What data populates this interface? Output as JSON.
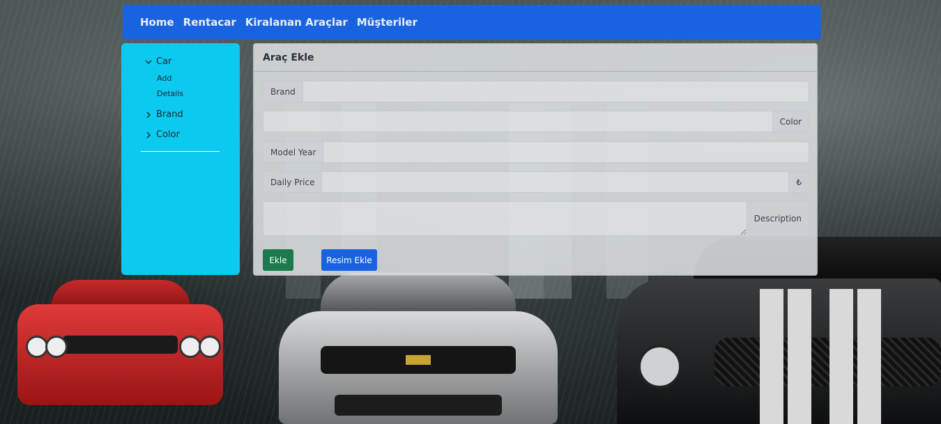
{
  "navbar": {
    "links": [
      "Home",
      "Rentacar",
      "Kiralanan Araçlar",
      "Müşteriler"
    ]
  },
  "sidebar": {
    "car": {
      "label": "Car",
      "children": [
        "Add",
        "Details"
      ]
    },
    "brand": {
      "label": "Brand"
    },
    "color": {
      "label": "Color"
    }
  },
  "form": {
    "title": "Araç Ekle",
    "brand_label": "Brand",
    "brand_value": "",
    "color_label": "Color",
    "color_value": "",
    "model_year_label": "Model Year",
    "model_year_value": "",
    "daily_price_label": "Daily Price",
    "daily_price_value": "",
    "currency_symbol": "₺",
    "description_label": "Description",
    "description_value": "",
    "add_button": "Ekle",
    "add_image_button": "Resim Ekle"
  },
  "colors": {
    "navbar": "#1a63e0",
    "sidebar": "#0bc9ef",
    "add_button": "#1a7a4d",
    "add_image_button": "#1a63e0"
  }
}
